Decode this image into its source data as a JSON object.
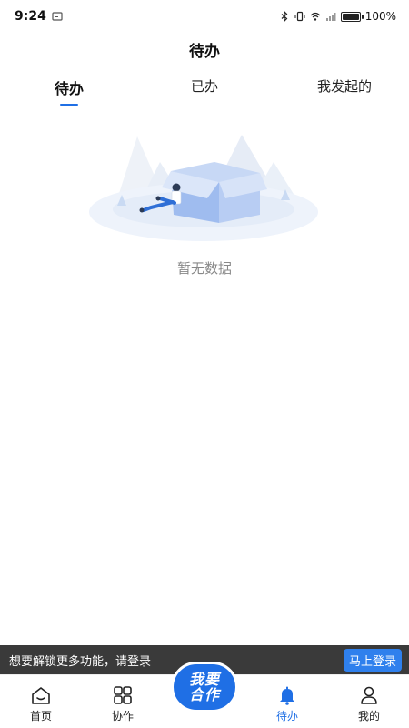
{
  "status_bar": {
    "time": "9:24",
    "battery": "100%",
    "battery_level": 1.0
  },
  "header": {
    "title": "待办"
  },
  "tabs": [
    {
      "label": "待办",
      "active": true
    },
    {
      "label": "已办",
      "active": false
    },
    {
      "label": "我发起的",
      "active": false
    }
  ],
  "empty_state": {
    "text": "暂无数据"
  },
  "login_banner": {
    "message": "想要解锁更多功能，请登录",
    "button_label": "马上登录"
  },
  "bottom_nav": {
    "items": [
      {
        "label": "首页",
        "icon": "home-icon"
      },
      {
        "label": "协作",
        "icon": "grid-icon"
      },
      {
        "label": "待办",
        "icon": "bell-icon",
        "active": true
      },
      {
        "label": "我的",
        "icon": "user-icon"
      }
    ],
    "center": {
      "line1": "我要",
      "line2": "合作"
    }
  },
  "colors": {
    "accent": "#1f6fe5",
    "banner_bg": "#3a3a3a",
    "login_button": "#2f80ed"
  }
}
